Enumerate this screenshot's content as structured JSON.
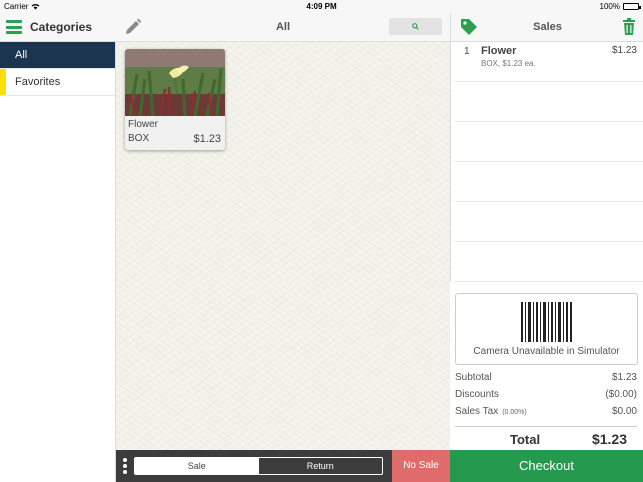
{
  "status_bar": {
    "carrier": "Carrier",
    "time": "4:09 PM",
    "battery": "100%"
  },
  "categories": {
    "title": "Categories",
    "items": [
      {
        "label": "All",
        "active": true
      },
      {
        "label": "Favorites",
        "color": "#ffde00"
      }
    ]
  },
  "products": {
    "title": "All",
    "items": [
      {
        "name": "Flower",
        "unit": "BOX",
        "price": "$1.23"
      }
    ],
    "footer": {
      "segment": [
        "Sale",
        "Return"
      ],
      "selected": "Sale",
      "no_sale_label": "No Sale"
    }
  },
  "sales": {
    "title": "Sales",
    "lines": [
      {
        "qty": "1",
        "name": "Flower",
        "desc": "BOX, $1.23 ea.",
        "price": "$1.23"
      }
    ],
    "camera_message": "Camera Unavailable in Simulator",
    "subtotal_label": "Subtotal",
    "subtotal": "$1.23",
    "discounts_label": "Discounts",
    "discounts": "($0.00)",
    "tax_label": "Sales Tax",
    "tax_rate": "(0.00%)",
    "tax": "$0.00",
    "total_label": "Total",
    "total": "$1.23",
    "checkout_label": "Checkout"
  },
  "colors": {
    "accent_green": "#259a4f",
    "active_category": "#1b3550",
    "no_sale_red": "#e06b6b"
  },
  "icons": [
    "menu-icon",
    "pencil-icon",
    "search-icon",
    "tag-icon",
    "trash-icon",
    "barcode-icon",
    "wifi-icon",
    "battery-icon",
    "more-icon"
  ]
}
